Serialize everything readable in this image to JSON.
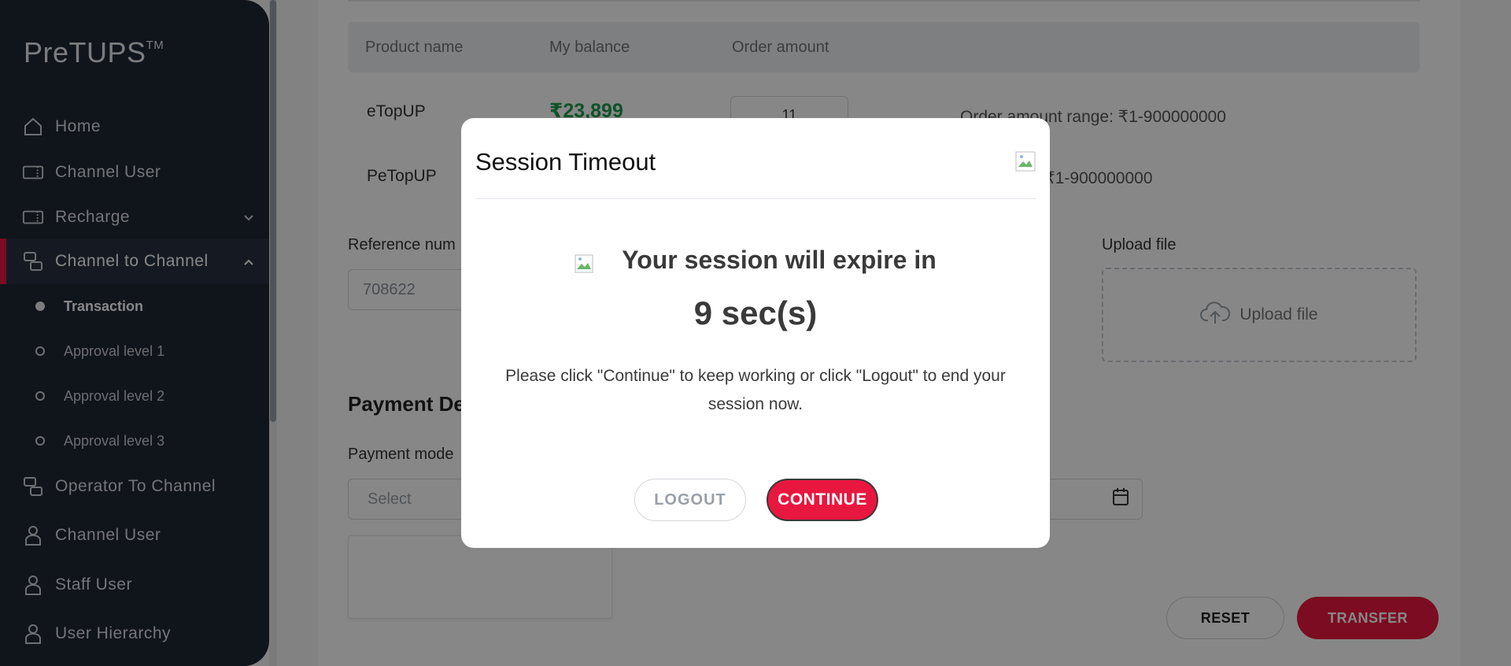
{
  "sidebar": {
    "logo": "PreTUPS",
    "logo_tm": "TM",
    "items": [
      {
        "label": "Home",
        "icon": "home-icon"
      },
      {
        "label": "Channel User",
        "icon": "ticket-icon"
      },
      {
        "label": "Recharge",
        "icon": "ticket-icon"
      },
      {
        "label": "Channel to Channel",
        "icon": "transfer-icon"
      },
      {
        "label": "Operator To Channel",
        "icon": "transfer-icon"
      },
      {
        "label": "Channel User",
        "icon": "user-icon"
      },
      {
        "label": "Staff User",
        "icon": "user-icon"
      },
      {
        "label": "User Hierarchy",
        "icon": "user-icon"
      }
    ],
    "sub_items": [
      {
        "label": "Transaction"
      },
      {
        "label": "Approval level 1"
      },
      {
        "label": "Approval level 2"
      },
      {
        "label": "Approval level 3"
      }
    ]
  },
  "table": {
    "headers": [
      "Product name",
      "My balance",
      "Order amount"
    ],
    "rows": [
      {
        "product": "eTopUP",
        "balance": "₹23,899",
        "amount": "11",
        "range": "Order amount range: ₹1-900000000"
      },
      {
        "product": "PeTopUP",
        "balance": "",
        "amount": "",
        "range": "range: ₹1-900000000"
      }
    ]
  },
  "form": {
    "reference_label": "Reference num",
    "reference_value": "708622",
    "upload_label": "Upload file",
    "upload_button": "Upload file",
    "payment_title": "Payment De",
    "payment_mode_label": "Payment mode",
    "payment_mode_placeholder": "Select"
  },
  "actions": {
    "reset": "RESET",
    "transfer": "TRANSFER"
  },
  "modal": {
    "title": "Session Timeout",
    "expire_text": "Your session will expire in",
    "timer": "9 sec(s)",
    "message": "Please click \"Continue\" to keep working or click \"Logout\" to end your session now.",
    "logout": "LOGOUT",
    "continue": "CONTINUE"
  },
  "colors": {
    "accent": "#e8173f",
    "sidebar_bg": "#1f2733",
    "balance_green": "#1e9b4d"
  }
}
